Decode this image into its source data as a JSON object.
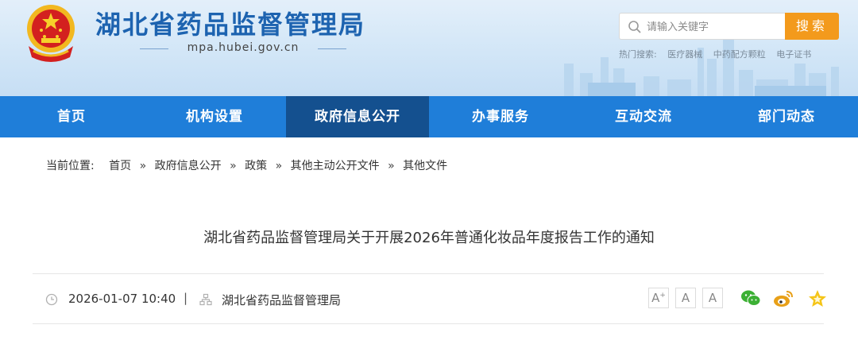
{
  "header": {
    "site_title": "湖北省药品监督管理局",
    "site_url": "mpa.hubei.gov.cn",
    "emblem_icon": "national-emblem-icon"
  },
  "search": {
    "placeholder": "请输入关键字",
    "button_label": "搜索",
    "hot_label": "热门搜索:",
    "hot_terms": [
      "医疗器械",
      "中药配方颗粒",
      "电子证书"
    ]
  },
  "nav": {
    "items": [
      "首页",
      "机构设置",
      "政府信息公开",
      "办事服务",
      "互动交流",
      "部门动态"
    ],
    "active": "政府信息公开"
  },
  "breadcrumb": {
    "label": "当前位置:",
    "items": [
      "首页",
      "政府信息公开",
      "政策",
      "其他主动公开文件",
      "其他文件"
    ],
    "separator": "»"
  },
  "article": {
    "title": "湖北省药品监督管理局关于开展2026年普通化妆品年度报告工作的通知",
    "date": "2026-01-07 10:40",
    "divider": "|",
    "source": "湖北省药品监督管理局"
  },
  "tools": {
    "font_sizes": [
      "A",
      "A",
      "A"
    ],
    "font_size_marks": [
      "+",
      "",
      ""
    ],
    "share": [
      "wechat-icon",
      "weibo-icon",
      "favorite-star-icon"
    ]
  },
  "colors": {
    "brand_blue": "#1d63b0",
    "nav_blue": "#1f7ed9",
    "nav_active": "#14508f",
    "search_orange": "#f39a1c",
    "wechat_green": "#3cb034",
    "weibo_orange": "#e8a018",
    "star_yellow": "#f5c518"
  }
}
